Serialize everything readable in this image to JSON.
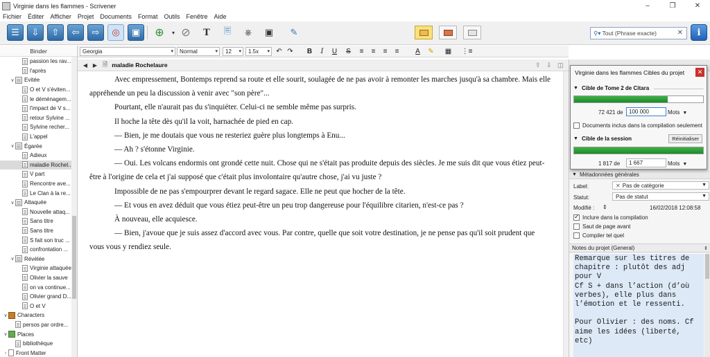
{
  "window": {
    "title": "Virginie dans les flammes - Scrivener"
  },
  "menu": [
    "Fichier",
    "Éditer",
    "Afficher",
    "Projet",
    "Documents",
    "Format",
    "Outils",
    "Fenêtre",
    "Aide"
  ],
  "search": {
    "placeholder": "Tout (Phrase exacte)"
  },
  "binder": {
    "header": "Binder",
    "items": [
      {
        "label": "passion les rav...",
        "indent": 2,
        "type": "doc",
        "selected": false
      },
      {
        "label": "l'après",
        "indent": 2,
        "type": "doc",
        "selected": false
      },
      {
        "label": "Evitée",
        "indent": 1,
        "type": "folder",
        "expanded": true,
        "selected": false
      },
      {
        "label": "O et V s'éviten...",
        "indent": 2,
        "type": "doc",
        "selected": false
      },
      {
        "label": "le déménagem...",
        "indent": 2,
        "type": "doc",
        "selected": false
      },
      {
        "label": "l'impact de V s...",
        "indent": 2,
        "type": "doc",
        "selected": false
      },
      {
        "label": "retour Sylvine ...",
        "indent": 2,
        "type": "doc",
        "selected": false
      },
      {
        "label": "Sylvine recher...",
        "indent": 2,
        "type": "doc",
        "selected": false
      },
      {
        "label": "L'appel",
        "indent": 2,
        "type": "doc",
        "selected": false
      },
      {
        "label": "Égarée",
        "indent": 1,
        "type": "folder",
        "expanded": true,
        "selected": false
      },
      {
        "label": "Adieux",
        "indent": 2,
        "type": "doc",
        "selected": false
      },
      {
        "label": "maladie Rochel...",
        "indent": 2,
        "type": "doc",
        "selected": true
      },
      {
        "label": "V part",
        "indent": 2,
        "type": "doc",
        "selected": false
      },
      {
        "label": "Rencontre ave...",
        "indent": 2,
        "type": "doc",
        "selected": false
      },
      {
        "label": "Le Clan à la re...",
        "indent": 2,
        "type": "doc",
        "selected": false
      },
      {
        "label": "Attaquée",
        "indent": 1,
        "type": "folder",
        "expanded": true,
        "selected": false
      },
      {
        "label": "Nouvelle attaq...",
        "indent": 2,
        "type": "doc",
        "selected": false
      },
      {
        "label": "Sans titre",
        "indent": 2,
        "type": "doc",
        "selected": false
      },
      {
        "label": "Sans titre",
        "indent": 2,
        "type": "doc",
        "selected": false
      },
      {
        "label": "S fait son truc ...",
        "indent": 2,
        "type": "doc",
        "selected": false
      },
      {
        "label": "confrontation ...",
        "indent": 2,
        "type": "doc",
        "selected": false
      },
      {
        "label": "Révélée",
        "indent": 1,
        "type": "folder",
        "expanded": true,
        "selected": false
      },
      {
        "label": "Virginie attaquée",
        "indent": 2,
        "type": "doc",
        "selected": false
      },
      {
        "label": "Olivier la sauve",
        "indent": 2,
        "type": "doc",
        "selected": false
      },
      {
        "label": "on va continue...",
        "indent": 2,
        "type": "doc",
        "selected": false
      },
      {
        "label": "Olivier grand D...",
        "indent": 2,
        "type": "doc",
        "selected": false
      },
      {
        "label": "O et V",
        "indent": 2,
        "type": "doc",
        "selected": false
      },
      {
        "label": "Characters",
        "indent": 0,
        "type": "characters",
        "expanded": true,
        "selected": false
      },
      {
        "label": "persos par ordre...",
        "indent": 1,
        "type": "doc",
        "selected": false
      },
      {
        "label": "Places",
        "indent": 0,
        "type": "places",
        "expanded": true,
        "selected": false
      },
      {
        "label": "bibliothèque",
        "indent": 1,
        "type": "doc",
        "selected": false
      },
      {
        "label": "Front Matter",
        "indent": 0,
        "type": "frontmatter",
        "expanded": false,
        "selected": false
      }
    ]
  },
  "format_bar": {
    "font": "Georgia",
    "style": "Normal",
    "size": "12",
    "line_spacing": "1.5x",
    "bold": "B",
    "italic": "I",
    "underline": "U",
    "strike": "S"
  },
  "editor": {
    "doc_title": "maladie Rochelaure",
    "paragraphs": [
      "Avec empressement, Bontemps reprend sa route et elle sourit, soulagée de ne pas avoir à remonter les marches jusqu'à sa chambre. Mais elle appréhende un peu la discussion à venir avec \"son père\"...",
      "Pourtant, elle n'aurait pas du s'inquiéter. Celui-ci ne semble même pas surpris.",
      "Il hoche la tête dès qu'il la voit, harnachée de pied en cap.",
      "— Bien, je me doutais que vous ne resteriez guère plus longtemps à Enu...",
      "— Ah ? s'étonne Virginie.",
      "— Oui. Les volcans endormis ont grondé cette nuit. Chose qui ne s'était pas produite depuis des siècles. Je me suis dit que vous étiez peut-être à l'origine de cela et j'ai supposé que c'était plus involontaire qu'autre chose, j'ai vu juste ?",
      "Impossible de ne pas s'empourprer devant le regard sagace. Elle ne peut que hocher de la tête.",
      "— Et vous en avez déduit que vous étiez peut-être un peu trop dangereuse pour l'équilibre citarien, n'est-ce pas ?",
      "À nouveau, elle acquiesce.",
      "— Bien, j'avoue que je suis assez d'accord avec vous. Par contre, quelle que soit votre destination, je ne pense pas qu'il soit prudent que vous vous y rendiez seule."
    ]
  },
  "inspector": {
    "meta_header": "Métadonnées générales",
    "label_caption": "Label:",
    "label_value": "Pas de catégorie",
    "status_caption": "Statut:",
    "status_value": "Pas de statut",
    "modified_caption": "Modifié :",
    "modified_value": "16/02/2018 12:08:58",
    "include_compile": "Inclure dans la compilation",
    "page_break": "Saut de page avant",
    "compile_as_is": "Compiler tel quel",
    "notes_header": "Notes du projet (General)",
    "notes_text": "Remarque sur les titres de chapitre : plutôt des adj pour V\nCf S + dans l’action (d’où verbes), elle plus dans l’émotion et le ressenti.\n\nPour Olivier : des noms. Cf aime les idées (liberté, etc)"
  },
  "targets_popup": {
    "title": "Virginie dans les flammes Cibles du projet",
    "draft_section": "Cible de Tome 2 de Citara",
    "draft_count": "72 421 de",
    "draft_target": "100 000",
    "draft_unit": "Mots",
    "draft_progress": 0.724,
    "include_only": "Documents inclus dans la compilation seulement",
    "session_section": "Cible de la session",
    "reset_label": "Réinitialiser",
    "session_count": "1 817 de",
    "session_target": "1 667",
    "session_unit": "Mots",
    "session_progress": 1.0
  },
  "colors": {
    "progress_green": "#1d8a27",
    "notes_bg": "#dde9f7",
    "close_red": "#c9302c"
  }
}
